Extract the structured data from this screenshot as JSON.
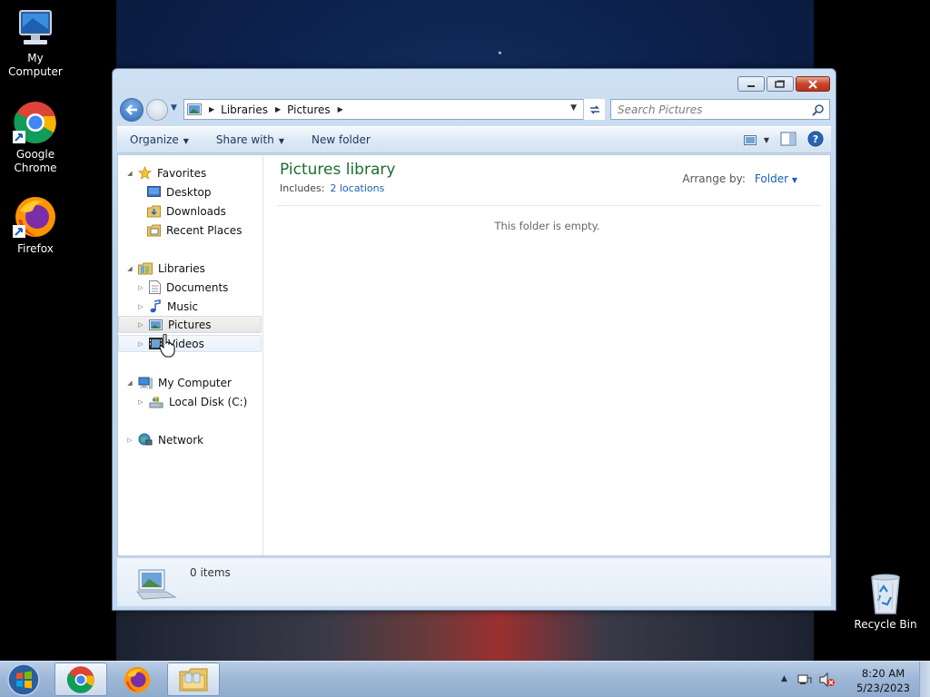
{
  "desktop": {
    "icons": [
      {
        "label": "My Computer",
        "icon": "computer-icon"
      },
      {
        "label": "Google Chrome",
        "icon": "chrome-icon"
      },
      {
        "label": "Firefox",
        "icon": "firefox-icon"
      },
      {
        "label": "Recycle Bin",
        "icon": "recycle-bin-icon"
      }
    ]
  },
  "window": {
    "title_buttons": [
      "minimize",
      "maximize",
      "close"
    ],
    "address": {
      "crumbs": [
        "Libraries",
        "Pictures"
      ]
    },
    "search": {
      "placeholder": "Search Pictures"
    },
    "commands": {
      "organize": "Organize",
      "share_with": "Share with",
      "new_folder": "New folder"
    },
    "nav_tree": {
      "favorites": "Favorites",
      "desktop": "Desktop",
      "downloads": "Downloads",
      "recent_places": "Recent Places",
      "libraries": "Libraries",
      "documents": "Documents",
      "music": "Music",
      "pictures": "Pictures",
      "videos": "Videos",
      "my_computer": "My Computer",
      "local_disk": "Local Disk (C:)",
      "network": "Network"
    },
    "library": {
      "title": "Pictures library",
      "includes_label": "Includes:",
      "locations": "2 locations",
      "arrange_label": "Arrange by:",
      "arrange_value": "Folder",
      "empty_message": "This folder is empty."
    },
    "details": {
      "count": "0 items"
    }
  },
  "taskbar": {
    "clock_time": "8:20 AM",
    "clock_date": "5/23/2023"
  },
  "colors": {
    "library_title": "#1e6c30",
    "link": "#1a5fb4",
    "taskbar": "#9fb8d7"
  }
}
